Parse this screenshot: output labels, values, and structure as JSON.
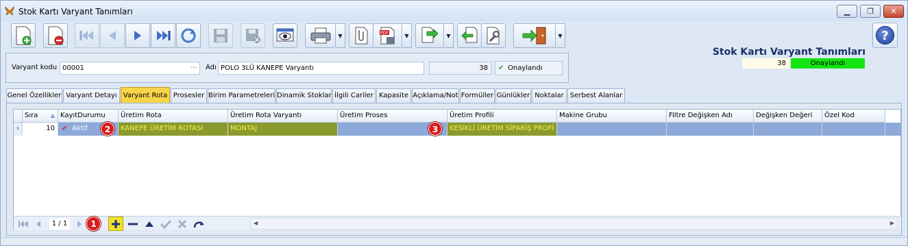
{
  "window": {
    "title": "Stok Kartı Varyant Tanımları",
    "min_label": "▁",
    "max_label": "❐",
    "close_label": "✕"
  },
  "toolbar": {
    "buttons": [
      "new-icon",
      "delete-icon",
      "first-icon",
      "prev-icon",
      "next-icon",
      "last-icon",
      "refresh-icon",
      "save-icon",
      "cancel-save-icon",
      "preview-icon",
      "print-icon",
      "attach-icon",
      "pdf-icon",
      "export-icon",
      "back-icon",
      "tools-icon",
      "exit-icon"
    ]
  },
  "header": {
    "title": "Stok Kartı Varyant Tanımları",
    "record_no": "38",
    "status": "Onaylandı",
    "help": "?"
  },
  "form": {
    "code_label": "Varyant kodu",
    "code_value": "00001",
    "name_label": "Adı",
    "name_value": "POLO 3LÜ KANEPE Varyantı",
    "number_value": "38",
    "status_value": "Onaylandı",
    "dots": "···"
  },
  "tabs": [
    "Genel Özellikler",
    "Varyant Detayı",
    "Varyant Rota",
    "Prosesler",
    "Birim Parametreleri",
    "Dinamik Stoklar",
    "İlgili Cariler",
    "Kapasite",
    "Açıklama/Not",
    "Formüller",
    "Günlükler",
    "Noktalar",
    "Serbest Alanlar"
  ],
  "grid": {
    "columns": [
      "Sıra",
      "KayıtDurumu",
      "Üretim Rota",
      "Üretim Rota Varyantı",
      "Üretim Proses",
      "Üretim Profili",
      "Makine Grubu",
      "Filtre Değişken Adı",
      "Değişken Değeri",
      "Özel Kod"
    ],
    "row": {
      "sira": "10",
      "durum": "Aktif",
      "rota": "KANEPE ÜRETİM ROTASI",
      "varyant": "MONTAJ",
      "proses": "",
      "profil": "KESİKLİ ÜRETİM SİPARİŞ PROFİ",
      "makine": "",
      "filtre": "",
      "deger": "",
      "ozel": ""
    },
    "row_marker": "›"
  },
  "navigator": {
    "info": "1 / 1"
  },
  "badges": [
    "1",
    "2",
    "3"
  ],
  "colors": {
    "active_tab": "#f8d44a",
    "status_green": "#12e512",
    "selected_row": "#8da9d9",
    "highlight_cell": "#8a9a2c",
    "badge": "#d81e1e"
  }
}
